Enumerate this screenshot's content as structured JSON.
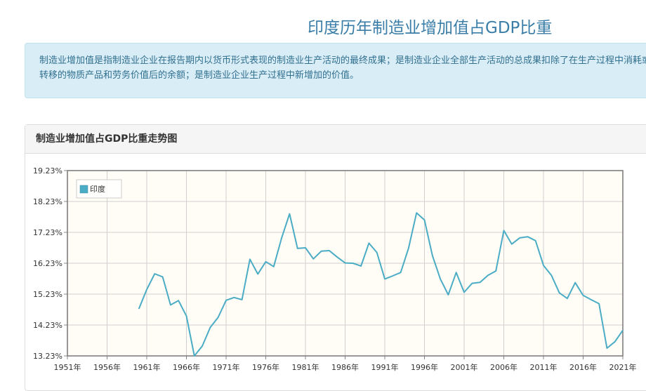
{
  "page": {
    "title": "印度历年制造业增加值占GDP比重",
    "description": "制造业增加值是指制造业企业在报告期内以货币形式表现的制造业生产活动的最终成果；是制造业企业全部生产活动的总成果扣除了在生产过程中消耗或转移的物质产品和劳务价值后的余额；是制造业企业生产过程中新增加的价值。"
  },
  "panel": {
    "title": "制造业增加值占GDP比重走势图"
  },
  "chart_data": {
    "type": "line",
    "legend_position": "top-left",
    "grid": true,
    "ylim": [
      13.23,
      19.23
    ],
    "xlim": [
      1951,
      2021
    ],
    "ytick_labels": [
      "19.23%",
      "18.23%",
      "17.23%",
      "16.23%",
      "15.23%",
      "14.23%",
      "13.23%"
    ],
    "xtick_labels": [
      "1951年",
      "1956年",
      "1961年",
      "1966年",
      "1971年",
      "1976年",
      "1981年",
      "1986年",
      "1991年",
      "1996年",
      "2001年",
      "2006年",
      "2011年",
      "2016年",
      "2021年"
    ],
    "colors": {
      "series": "#4bacc6",
      "plot_bg": "#fffdf5",
      "grid": "#d0d0d0"
    },
    "series": [
      {
        "name": "印度",
        "x": [
          1960,
          1961,
          1962,
          1963,
          1964,
          1965,
          1966,
          1967,
          1968,
          1969,
          1970,
          1971,
          1972,
          1973,
          1974,
          1975,
          1976,
          1977,
          1978,
          1979,
          1980,
          1981,
          1982,
          1983,
          1984,
          1985,
          1986,
          1987,
          1988,
          1989,
          1990,
          1991,
          1992,
          1993,
          1994,
          1995,
          1996,
          1997,
          1998,
          1999,
          2000,
          2001,
          2002,
          2003,
          2004,
          2005,
          2006,
          2007,
          2008,
          2009,
          2010,
          2011,
          2012,
          2013,
          2014,
          2015,
          2016,
          2017,
          2018,
          2019,
          2020,
          2021
        ],
        "values": [
          14.75,
          15.38,
          15.89,
          15.79,
          14.88,
          15.02,
          14.52,
          13.23,
          13.55,
          14.15,
          14.48,
          15.03,
          15.12,
          15.05,
          16.36,
          15.88,
          16.28,
          16.12,
          17.05,
          17.83,
          16.71,
          16.73,
          16.37,
          16.62,
          16.64,
          16.43,
          16.24,
          16.23,
          16.14,
          16.88,
          16.58,
          15.72,
          15.82,
          15.93,
          16.72,
          17.86,
          17.63,
          16.48,
          15.72,
          15.21,
          15.93,
          15.29,
          15.58,
          15.61,
          15.84,
          15.98,
          17.29,
          16.85,
          17.05,
          17.09,
          16.96,
          16.16,
          15.84,
          15.27,
          15.09,
          15.6,
          15.19,
          15.05,
          14.92,
          13.48,
          13.69,
          14.06
        ]
      }
    ]
  }
}
